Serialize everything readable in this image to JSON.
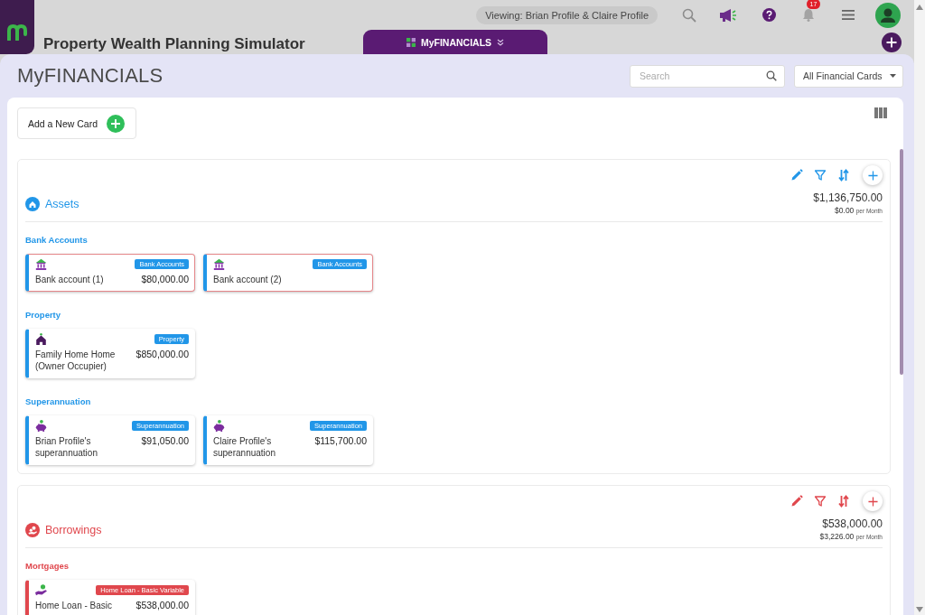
{
  "app": {
    "title": "Property Wealth Planning Simulator",
    "viewing": "Viewing: Brian Profile & Claire Profile",
    "notifications": "17"
  },
  "tab": {
    "label": "MyFINANCIALS"
  },
  "panel": {
    "title": "MyFINANCIALS",
    "search": {
      "placeholder": "Search"
    },
    "filter": {
      "value": "All Financial Cards"
    },
    "add_button": "Add a New Card"
  },
  "sections": [
    {
      "kind": "asset",
      "title": "Assets",
      "color": "#2196e8",
      "total": "$1,136,750.00",
      "monthly": "$0.00",
      "monthly_unit": "per Month",
      "groups": [
        {
          "title": "Bank Accounts",
          "items": [
            {
              "kind": "bank",
              "name": "Bank account (1)",
              "tag": "Bank Accounts",
              "value": "$80,000.00",
              "flagged": true
            },
            {
              "kind": "bank",
              "name": "Bank account (2)",
              "tag": "Bank Accounts",
              "flagged": true
            }
          ]
        },
        {
          "title": "Property",
          "items": [
            {
              "kind": "property",
              "name": "Family Home Home (Owner Occupier)",
              "tag": "Property",
              "value": "$850,000.00",
              "flagged": false
            }
          ]
        },
        {
          "title": "Superannuation",
          "items": [
            {
              "kind": "super",
              "name": "Brian Profile's superannuation",
              "tag": "Superannuation",
              "value": "$91,050.00",
              "flagged": false
            },
            {
              "kind": "super",
              "name": "Claire Profile's superannuation",
              "tag": "Superannuation",
              "value": "$115,700.00",
              "flagged": false
            }
          ]
        }
      ]
    },
    {
      "kind": "borrowing",
      "title": "Borrowings",
      "color": "#e0474d",
      "total": "$538,000.00",
      "monthly": "$3,226.00",
      "monthly_unit": "per Month",
      "groups": [
        {
          "title": "Mortgages",
          "items": [
            {
              "kind": "loan",
              "name": "Home Loan - Basic",
              "tag": "Home Loan - Basic Variable",
              "value": "$538,000.00",
              "flagged": false
            }
          ]
        }
      ]
    }
  ]
}
